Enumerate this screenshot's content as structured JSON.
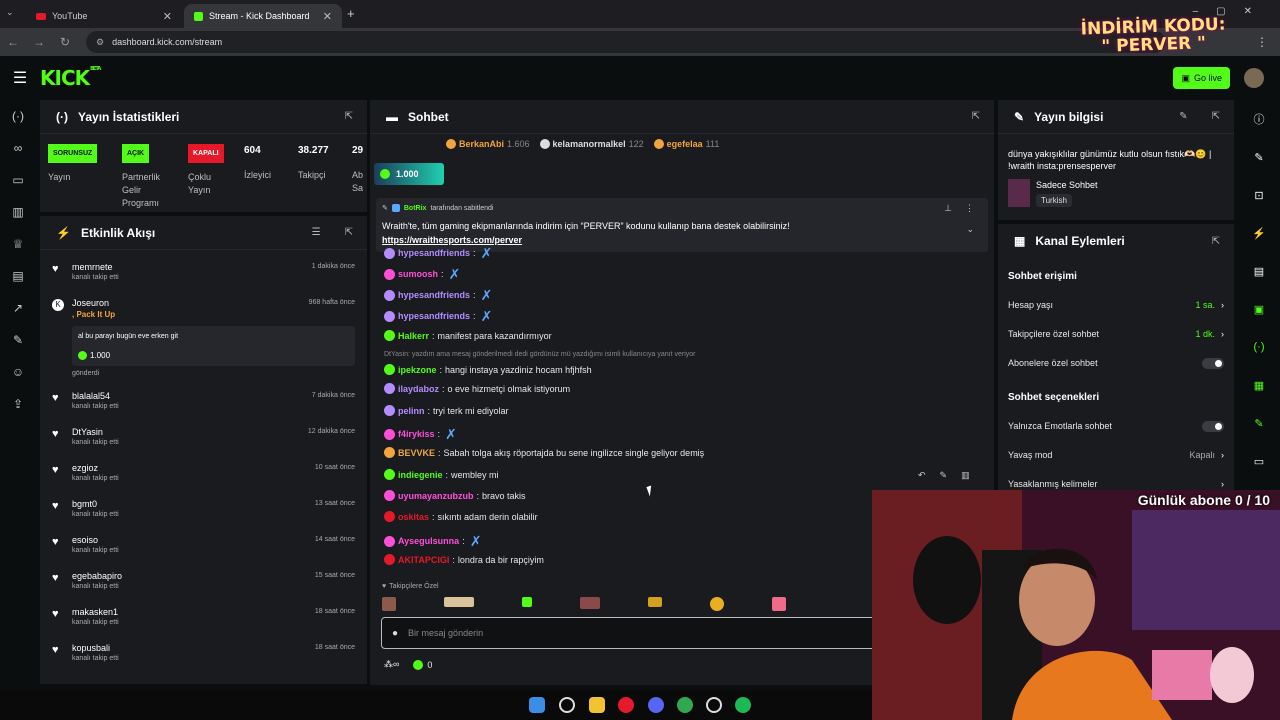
{
  "browser": {
    "tabs": [
      {
        "label": "YouTube",
        "active": false
      },
      {
        "label": "Stream - Kick Dashboard",
        "active": true
      }
    ],
    "url": "dashboard.kick.com/stream"
  },
  "overlay": {
    "promo_line1": "İNDİRİM KODU:",
    "promo_line2": "\" PERVER \"",
    "daily_sub": "Günlük abone 0 / 10"
  },
  "header": {
    "logo": "KICK",
    "beta": "BETA",
    "go_live": "Go live"
  },
  "stats": {
    "title": "Yayın İstatistikleri",
    "items": [
      {
        "badge": "SORUNSUZ",
        "label": "Yayın",
        "color": "green"
      },
      {
        "badge": "AÇIK",
        "label": "Partnerlik Gelir Programı",
        "color": "green"
      },
      {
        "badge": "KAPALI",
        "label": "Çoklu Yayın",
        "color": "red"
      },
      {
        "value": "604",
        "label": "İzleyici"
      },
      {
        "value": "38.277",
        "label": "Takipçi"
      },
      {
        "value": "29",
        "label": "Ab Sa"
      }
    ]
  },
  "activity": {
    "title": "Etkinlik Akışı",
    "events": [
      {
        "name": "memrnete",
        "sub": "kanalı takip etti",
        "time": "1 dakika önce"
      },
      {
        "name": "Joseuron",
        "time": "968 hafta önce",
        "gift": ", Pack It Up",
        "message": "al bu parayı bugün eve erken git",
        "amount": "1.000",
        "sub": "gönderdi"
      },
      {
        "name": "blalalal54",
        "sub": "kanalı takip etti",
        "time": "7 dakika önce"
      },
      {
        "name": "DtYasin",
        "sub": "kanalı takip etti",
        "time": "12 dakika önce"
      },
      {
        "name": "ezgioz",
        "sub": "kanalı takip etti",
        "time": "10 saat önce"
      },
      {
        "name": "bgmt0",
        "sub": "kanalı takip etti",
        "time": "13 saat önce"
      },
      {
        "name": "esoiso",
        "sub": "kanalı takip etti",
        "time": "14 saat önce"
      },
      {
        "name": "egebabapiro",
        "sub": "kanalı takip etti",
        "time": "15 saat önce"
      },
      {
        "name": "makasken1",
        "sub": "kanalı takip etti",
        "time": "18 saat önce"
      },
      {
        "name": "kopusbali",
        "sub": "kanalı takip etti",
        "time": "18 saat önce"
      }
    ]
  },
  "chat": {
    "title": "Sohbet",
    "top_gifters": [
      {
        "name": "BerkanAbi",
        "count": "1.606",
        "color": "#f2a53d"
      },
      {
        "name": "kelamanormalkel",
        "count": "122",
        "color": "#dddddd"
      },
      {
        "name": "egefelaa",
        "count": "111",
        "color": "#f2a53d"
      }
    ],
    "kicks_badge": "1.000",
    "pinned": {
      "by_user": "BotRix",
      "by_suffix": "tarafından sabitlendi",
      "text": "Wraith'te, tüm gaming ekipmanlarında indirim için “PERVER” kodunu kullanıp bana destek olabilirsiniz!",
      "link": "https://wraithesports.com/perver"
    },
    "messages": [
      {
        "user": "hypesandfriends",
        "text": "",
        "color": "#b48cff",
        "emote": true
      },
      {
        "user": "sumoosh",
        "text": "",
        "color": "#ff4fd8",
        "emote": true
      },
      {
        "user": "hypesandfriends",
        "text": "",
        "color": "#b48cff",
        "emote": true
      },
      {
        "user": "hypesandfriends",
        "text": "",
        "color": "#b48cff",
        "emote": true
      },
      {
        "user": "Halkerr",
        "text": "manifest para kazandırmıyor",
        "color": "#53fc18"
      },
      {
        "reply": "DtYasin: yazdım ama mesaj gönderilmedi dedi gördünüz mü yazdığımı isimli kullanıcıya yanıt veriyor"
      },
      {
        "user": "ipekzone",
        "text": "hangi instaya yazdiniz hocam hfjhfsh",
        "color": "#53fc18"
      },
      {
        "user": "ilaydaboz",
        "text": "o eve hizmetçi olmak istiyorum",
        "color": "#b48cff"
      },
      {
        "user": "pelinn",
        "text": "tryi terk mi ediyolar",
        "color": "#b48cff"
      },
      {
        "user": "f4irykiss",
        "text": "",
        "color": "#ff4fd8",
        "emote": true
      },
      {
        "user": "BEVVKE",
        "text": "Sabah tolga akış röportajda bu sene ingilizce single geliyor demiş",
        "color": "#f2a53d"
      },
      {
        "user": "indiegenie",
        "text": "wembley mi",
        "color": "#53fc18"
      },
      {
        "user": "uyumayanzubzub",
        "text": "bravo takis",
        "color": "#ff4fd8"
      },
      {
        "user": "oskitas",
        "text": "sıkıntı adam derin olabilir",
        "color": "#e5192a"
      },
      {
        "user": "Aysegulsunna",
        "text": "",
        "color": "#ff4fd8",
        "emote": true
      },
      {
        "user": "AKITAPCIGI",
        "text": "londra da bir rapçiyim",
        "color": "#e5192a"
      }
    ],
    "followers_only": "Takipçilere Özel",
    "input_placeholder": "Bir mesaj gönderin",
    "footer_count": "0"
  },
  "stream_info": {
    "title": "Yayın bilgisi",
    "stream_title": "dünya yakışıklılar günümüz kutlu olsun fıstık🫶🏻😊 | !wraith insta:prensesperver",
    "category": "Sadece Sohbet",
    "language": "Turkish"
  },
  "channel_actions": {
    "title": "Kanal Eylemleri",
    "chat_access_title": "Sohbet erişimi",
    "access_rows": [
      {
        "label": "Hesap yaşı",
        "value": "1 sa.",
        "type": "value"
      },
      {
        "label": "Takipçilere özel sohbet",
        "value": "1 dk.",
        "type": "value"
      },
      {
        "label": "Abonelere özel sohbet",
        "type": "toggle"
      }
    ],
    "options_title": "Sohbet seçenekleri",
    "option_rows": [
      {
        "label": "Yalnızca Emotlarla sohbet",
        "type": "toggle"
      },
      {
        "label": "Yavaş mod",
        "value": "Kapalı",
        "type": "value"
      },
      {
        "label": "Yasaklanmış kelimeler",
        "type": "value"
      }
    ]
  },
  "colors": {
    "accent": "#53fc18",
    "panel": "#191b1f",
    "background": "#0b0e0f"
  }
}
